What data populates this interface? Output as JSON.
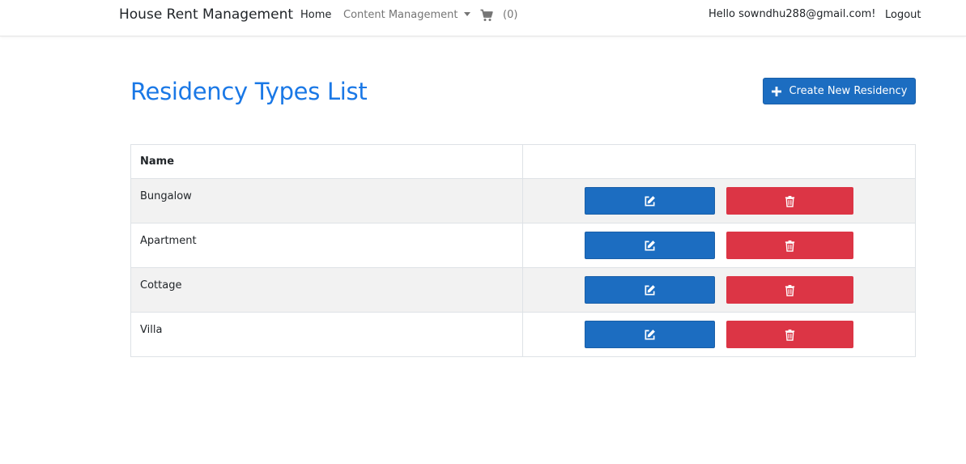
{
  "navbar": {
    "brand": "House Rent Management",
    "home": "Home",
    "content_management": "Content Management",
    "cart_icon": "shopping-cart-icon",
    "cart_count": "(0)",
    "greeting": "Hello sowndhu288@gmail.com!",
    "logout": "Logout"
  },
  "main": {
    "title": "Residency Types List",
    "create_button": {
      "label": "Create New Residency",
      "icon": "plus-icon"
    }
  },
  "table": {
    "headers": [
      "Name",
      ""
    ],
    "rows": [
      {
        "name": "Bungalow",
        "edit_icon": "edit-icon",
        "delete_icon": "trash-icon"
      },
      {
        "name": "Apartment",
        "edit_icon": "edit-icon",
        "delete_icon": "trash-icon"
      },
      {
        "name": "Cottage",
        "edit_icon": "edit-icon",
        "delete_icon": "trash-icon"
      },
      {
        "name": "Villa",
        "edit_icon": "edit-icon",
        "delete_icon": "trash-icon"
      }
    ]
  },
  "colors": {
    "title": "#1a78e6",
    "primary_button": "#1c6dc1",
    "danger_button": "#dc3545",
    "stripe": "#f2f2f2"
  }
}
